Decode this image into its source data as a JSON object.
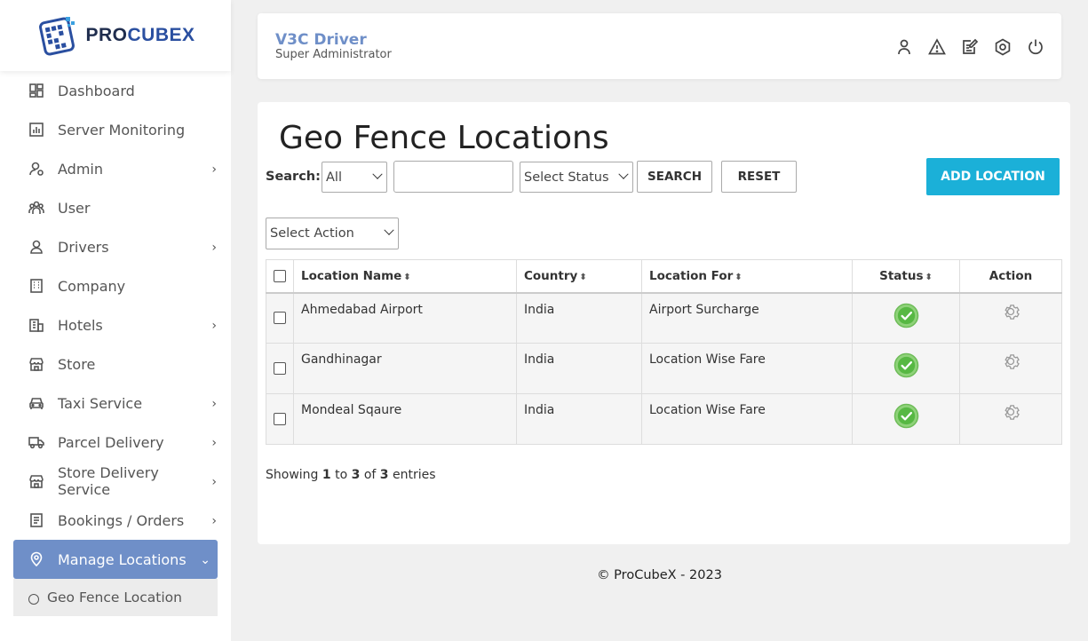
{
  "brand": {
    "pro": "PRO",
    "cubex": "CUBEX"
  },
  "sidebar": {
    "items": [
      {
        "label": "Dashboard",
        "icon": "dashboard-icon",
        "has_submenu": false
      },
      {
        "label": "Server Monitoring",
        "icon": "chart-icon",
        "has_submenu": false
      },
      {
        "label": "Admin",
        "icon": "admin-icon",
        "has_submenu": true
      },
      {
        "label": "User",
        "icon": "users-icon",
        "has_submenu": false
      },
      {
        "label": "Drivers",
        "icon": "driver-icon",
        "has_submenu": true
      },
      {
        "label": "Company",
        "icon": "building-icon",
        "has_submenu": false
      },
      {
        "label": "Hotels",
        "icon": "hotel-icon",
        "has_submenu": true
      },
      {
        "label": "Store",
        "icon": "store-icon",
        "has_submenu": false
      },
      {
        "label": "Taxi Service",
        "icon": "car-icon",
        "has_submenu": true
      },
      {
        "label": "Parcel Delivery",
        "icon": "truck-icon",
        "has_submenu": true
      },
      {
        "label": "Store Delivery Service",
        "icon": "store-icon",
        "has_submenu": true
      },
      {
        "label": "Bookings / Orders",
        "icon": "list-icon",
        "has_submenu": true
      },
      {
        "label": "Manage Locations",
        "icon": "location-pin-icon",
        "has_submenu": true,
        "active": true
      }
    ],
    "sub_item": "Geo Fence Location",
    "active_color": "#6f8fc8"
  },
  "header": {
    "user_name": "V3C Driver",
    "user_role": "Super Administrator",
    "icons": [
      "user-icon",
      "warning-icon",
      "edit-icon",
      "settings-icon",
      "power-icon"
    ]
  },
  "main": {
    "title": "Geo Fence Locations",
    "search_label": "Search:",
    "search_scope": "All",
    "search_value": "",
    "status_select": "Select Status",
    "search_button": "SEARCH",
    "reset_button": "RESET",
    "add_button": "ADD LOCATION",
    "action_select": "Select Action",
    "add_button_color": "#1bb0d8"
  },
  "table": {
    "columns": [
      "Location Name",
      "Country",
      "Location For",
      "Status",
      "Action"
    ],
    "rows": [
      {
        "name": "Ahmedabad Airport",
        "country": "India",
        "for": "Airport Surcharge",
        "status": "active"
      },
      {
        "name": "Gandhinagar",
        "country": "India",
        "for": "Location Wise Fare",
        "status": "active"
      },
      {
        "name": "Mondeal Sqaure",
        "country": "India",
        "for": "Location Wise Fare",
        "status": "active"
      }
    ]
  },
  "entries": {
    "prefix": "Showing",
    "from": "1",
    "to_word": "to",
    "to": "3",
    "of_word": "of",
    "total": "3",
    "suffix": "entries"
  },
  "footer": "© ProCubeX - 2023"
}
